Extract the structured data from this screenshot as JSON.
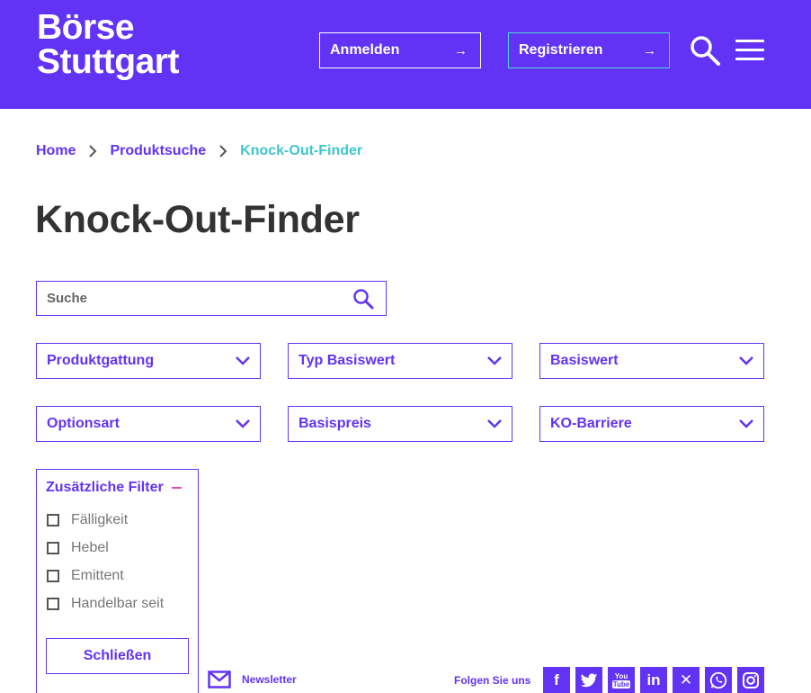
{
  "header": {
    "logo_line1": "Börse",
    "logo_line2": "Stuttgart",
    "login_label": "Anmelden",
    "register_label": "Registrieren",
    "arrow": "→"
  },
  "breadcrumb": [
    "Home",
    "Produktsuche",
    "Knock-Out-Finder"
  ],
  "page_title": "Knock-Out-Finder",
  "search": {
    "placeholder": "Suche"
  },
  "filters": [
    "Produktgattung",
    "Typ Basiswert",
    "Basiswert",
    "Optionsart",
    "Basispreis",
    "KO-Barriere"
  ],
  "extra_filters": {
    "title": "Zusätzliche Filter",
    "options": [
      "Fälligkeit",
      "Hebel",
      "Emittent",
      "Handelbar seit"
    ],
    "close_label": "Schließen"
  },
  "footer": {
    "newsletter": "Newsletter",
    "follow": "Folgen Sie uns",
    "social": [
      "facebook-icon",
      "twitter-icon",
      "youtube-icon",
      "linkedin-icon",
      "xing-icon",
      "whatsapp-icon",
      "instagram-icon"
    ],
    "social_text": {
      "facebook": "f",
      "youtube_top": "You",
      "youtube_bottom": "Tube",
      "linkedin": "in",
      "xing": "✕"
    }
  },
  "colors": {
    "brand": "#6233f5",
    "accent": "#3fc6d0",
    "minus": "#e04fa6"
  }
}
